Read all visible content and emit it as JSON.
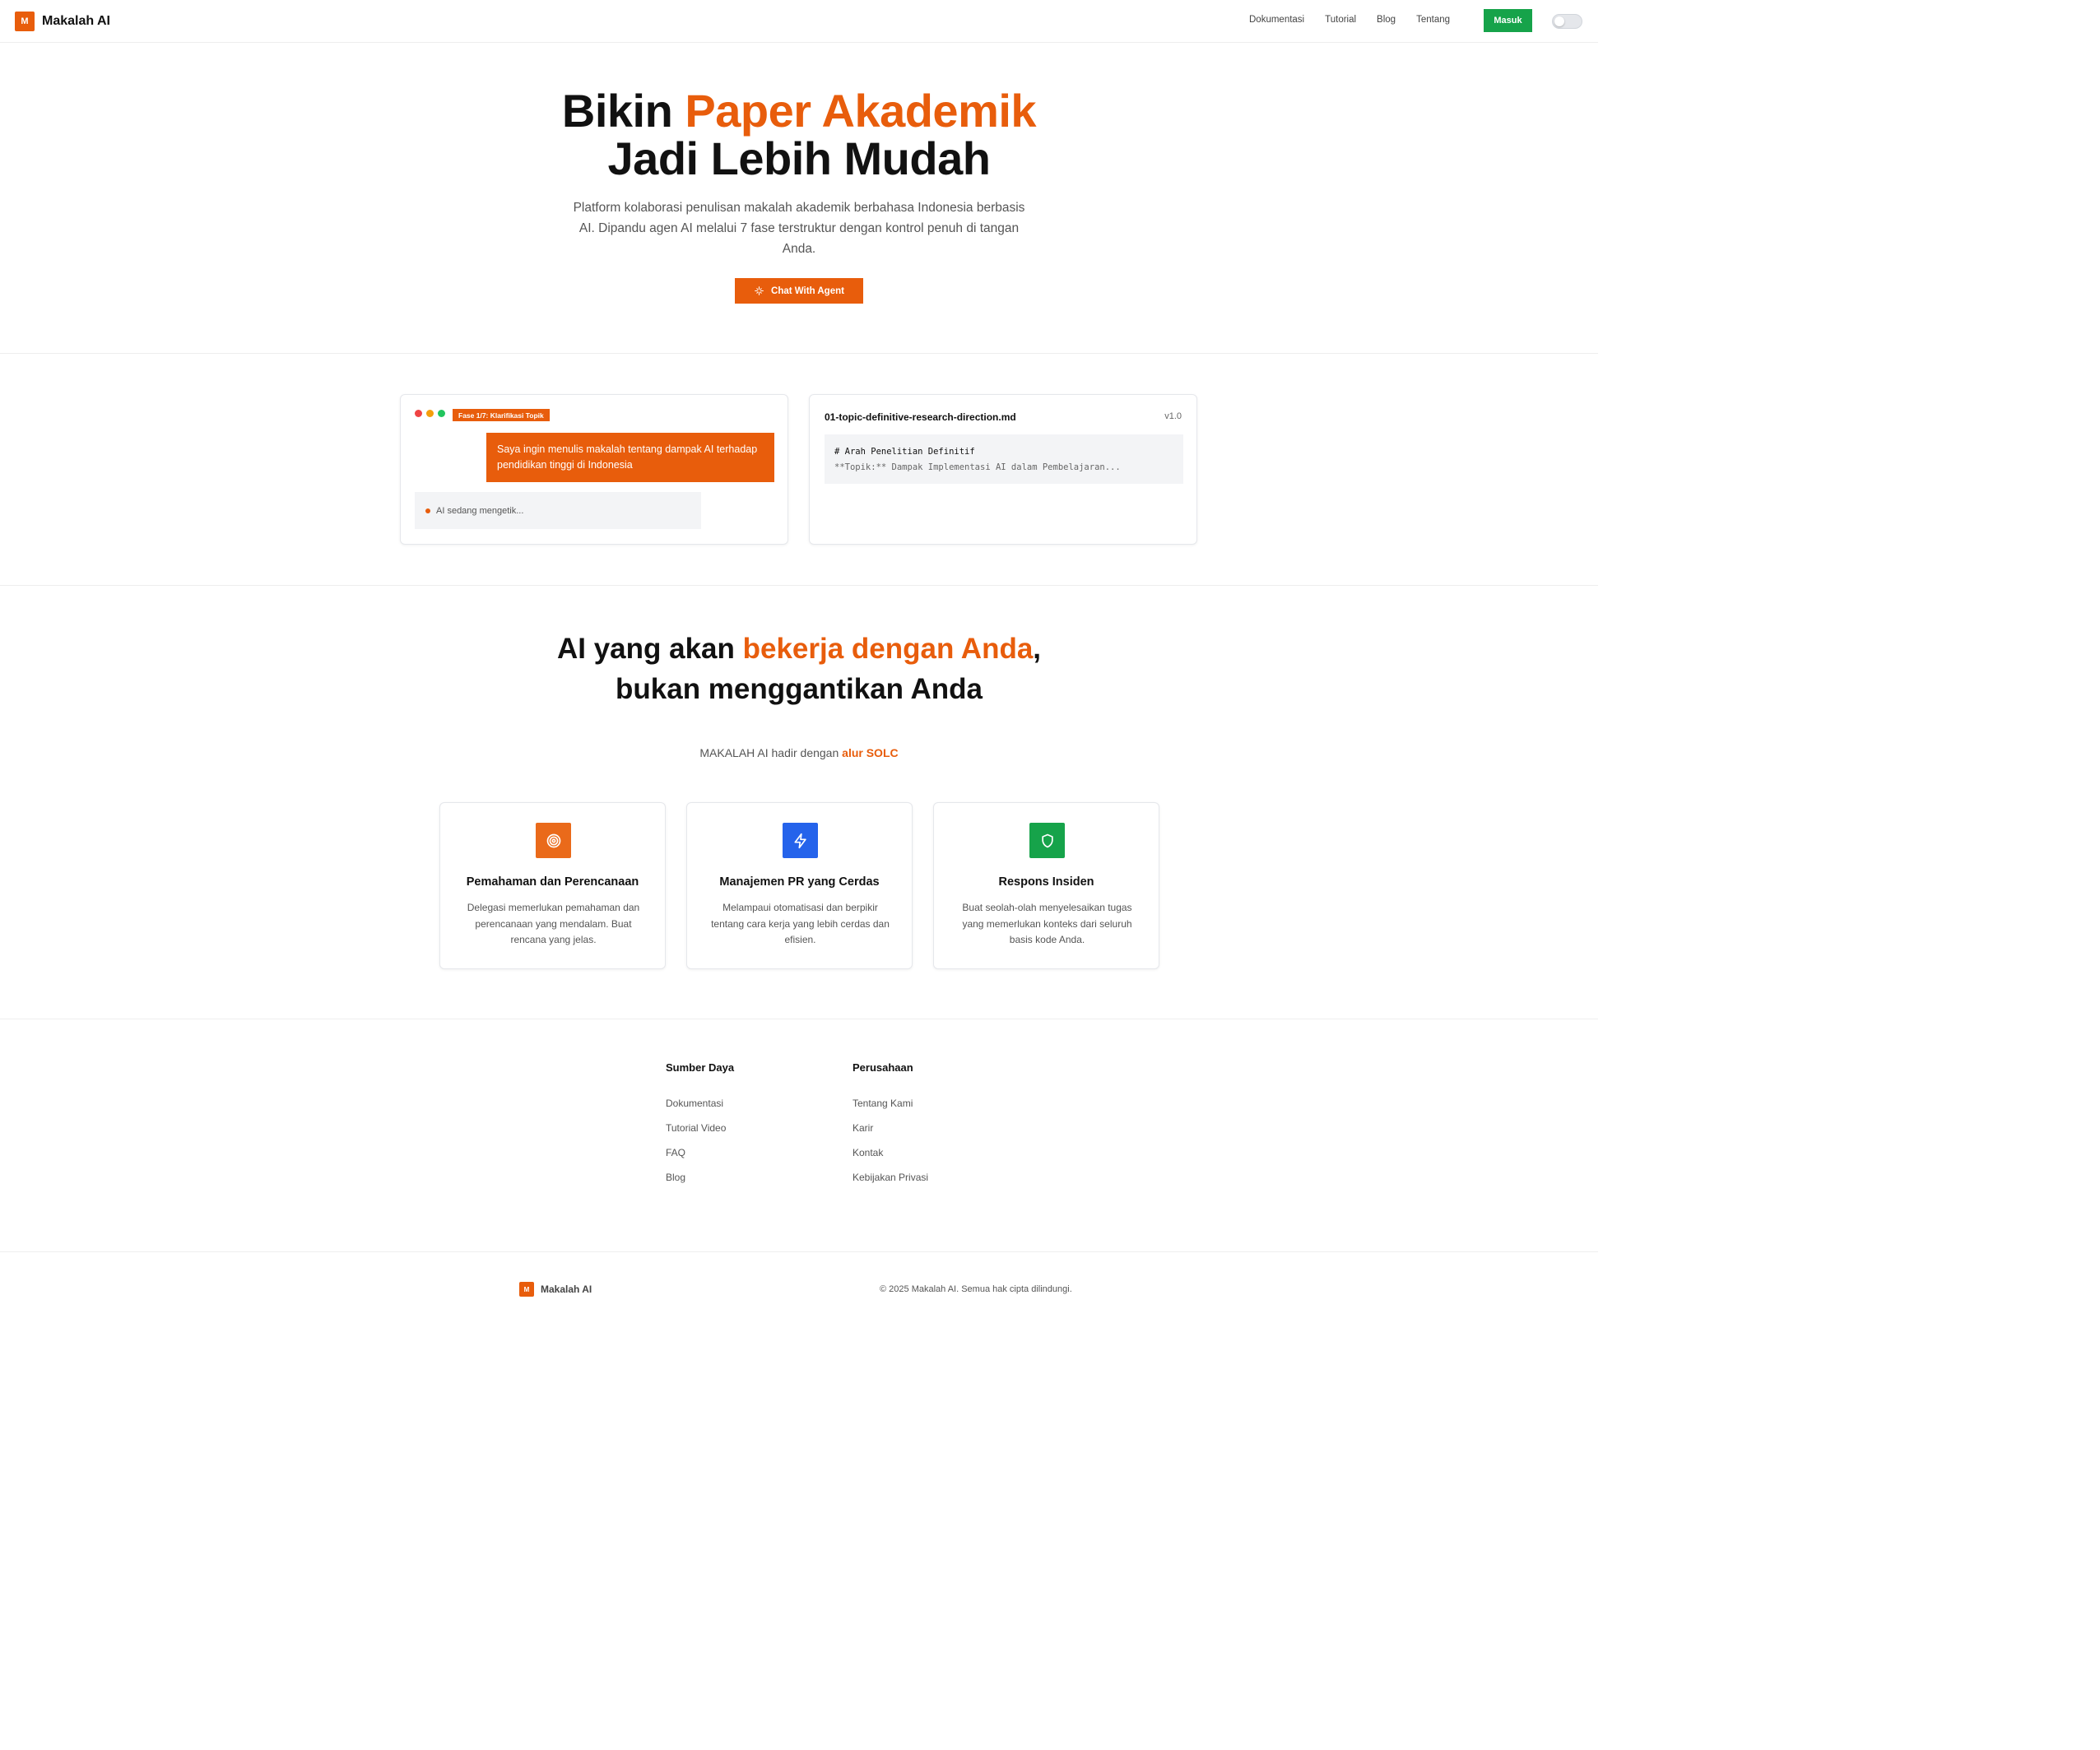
{
  "header": {
    "logo_letter": "M",
    "brand": "Makalah AI",
    "nav": [
      "Dokumentasi",
      "Tutorial",
      "Blog",
      "Tentang"
    ],
    "login_label": "Masuk"
  },
  "hero": {
    "title_prefix": "Bikin ",
    "title_accent": "Paper Akademik",
    "title_line2": "Jadi Lebih Mudah",
    "description": "Platform kolaborasi penulisan makalah akademik berbahasa Indonesia berbasis AI. Dipandu agen AI melalui 7 fase terstruktur dengan kontrol penuh di tangan Anda.",
    "cta_label": "Chat With Agent",
    "cta_icon": "sparkle-icon"
  },
  "chat_demo": {
    "phase_badge": "Fase 1/7: Klarifikasi Topik",
    "user_message": "Saya ingin menulis makalah tentang dampak AI terhadap pendidikan tinggi di Indonesia",
    "typing_text": "AI sedang mengetik...",
    "window_dot_colors": [
      "#ef4444",
      "#f59e0b",
      "#22c55e"
    ]
  },
  "doc_demo": {
    "filename": "01-topic-definitive-research-direction.md",
    "version": "v1.0",
    "line1": "# Arah Penelitian Definitif",
    "line2": "**Topik:** Dampak Implementasi AI dalam Pembelajaran..."
  },
  "section2": {
    "title_prefix": "AI yang akan ",
    "title_accent": "bekerja dengan Anda",
    "title_suffix": ",",
    "title_line2": "bukan menggantikan Anda",
    "subtitle_prefix": "MAKALAH AI hadir dengan ",
    "subtitle_accent": "alur SOLC"
  },
  "features": [
    {
      "icon": "target-icon",
      "color": "#ea6a1a",
      "title": "Pemahaman dan Perencanaan",
      "description": "Delegasi memerlukan pemahaman dan perencanaan yang mendalam. Buat rencana yang jelas."
    },
    {
      "icon": "lightning-icon",
      "color": "#2563eb",
      "title": "Manajemen PR yang Cerdas",
      "description": "Melampaui otomatisasi dan berpikir tentang cara kerja yang lebih cerdas dan efisien."
    },
    {
      "icon": "shield-icon",
      "color": "#16a34a",
      "title": "Respons Insiden",
      "description": "Buat seolah-olah menyelesaikan tugas yang memerlukan konteks dari seluruh basis kode Anda."
    }
  ],
  "footer": {
    "columns": [
      {
        "heading": "Sumber Daya",
        "links": [
          "Dokumentasi",
          "Tutorial Video",
          "FAQ",
          "Blog"
        ]
      },
      {
        "heading": "Perusahaan",
        "links": [
          "Tentang Kami",
          "Karir",
          "Kontak",
          "Kebijakan Privasi"
        ]
      }
    ],
    "brand": "Makalah AI",
    "logo_letter": "M",
    "copyright": "© 2025 Makalah AI. Semua hak cipta dilindungi."
  },
  "colors": {
    "accent": "#e85d0c",
    "login": "#16a34a"
  }
}
